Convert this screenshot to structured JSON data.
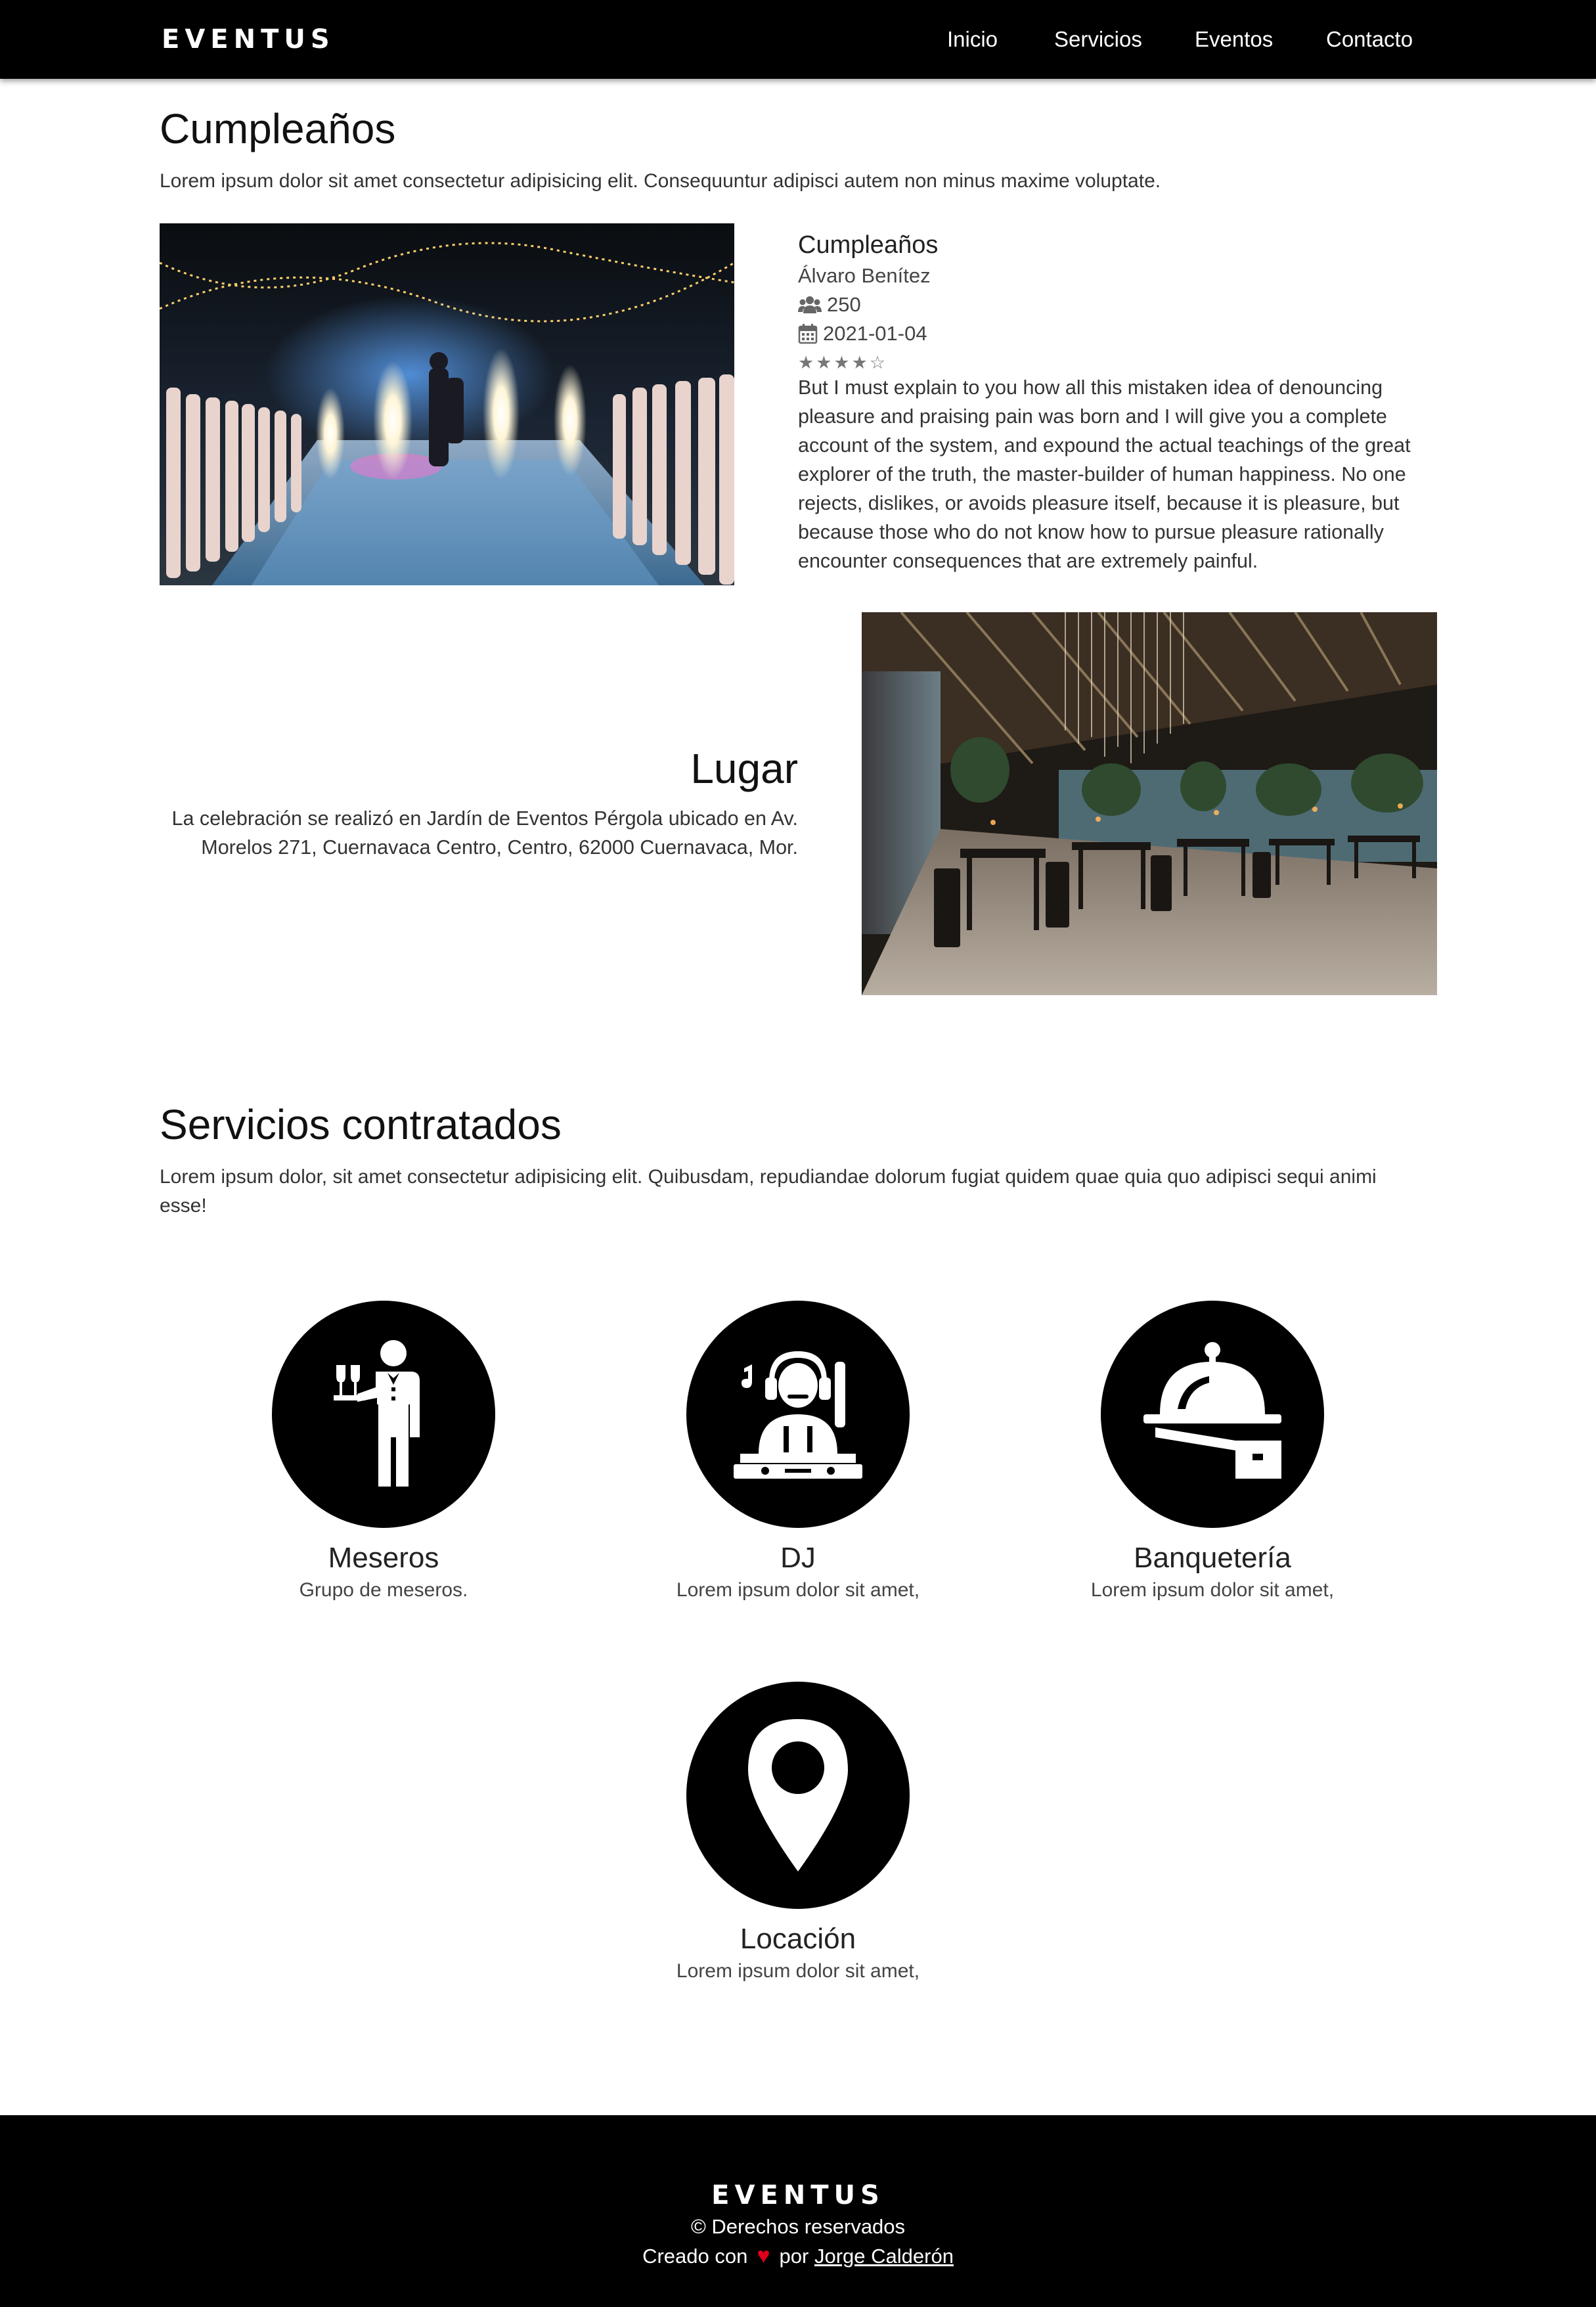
{
  "navbar": {
    "brand": "EVENTUS",
    "links": [
      "Inicio",
      "Servicios",
      "Eventos",
      "Contacto"
    ]
  },
  "event": {
    "section_title": "Cumpleaños",
    "intro": "Lorem ipsum dolor sit amet consectetur adipisicing elit. Consequuntur adipisci autem non minus maxime voluptate.",
    "type": "Cumpleaños",
    "client": "Álvaro Benítez",
    "guests": "250",
    "date": "2021-01-04",
    "rating": 4,
    "rating_max": 5,
    "rating_text": "★★★★☆",
    "description": "But I must explain to you how all this mistaken idea of denouncing pleasure and praising pain was born and I will give you a complete account of the system, and expound the actual teachings of the great explorer of the truth, the master-builder of human happiness. No one rejects, dislikes, or avoids pleasure itself, because it is pleasure, but because those who do not know how to pursue pleasure rationally encounter consequences that are extremely painful."
  },
  "place": {
    "title": "Lugar",
    "text": "La celebración se realizó en Jardín de Eventos Pérgola ubicado en Av. Morelos 271, Cuernavaca Centro, Centro, 62000 Cuernavaca, Mor."
  },
  "services": {
    "title": "Servicios contratados",
    "intro": "Lorem ipsum dolor, sit amet consectetur adipisicing elit. Quibusdam, repudiandae dolorum fugiat quidem quae quia quo adipisci sequi animi esse!",
    "items": [
      {
        "name": "Meseros",
        "desc": "Grupo de meseros.",
        "icon": "waiter-icon"
      },
      {
        "name": "DJ",
        "desc": "Lorem ipsum dolor sit amet,",
        "icon": "dj-icon"
      },
      {
        "name": "Banquetería",
        "desc": "Lorem ipsum dolor sit amet,",
        "icon": "food-tray-icon"
      },
      {
        "name": "Locación",
        "desc": "Lorem ipsum dolor sit amet,",
        "icon": "location-pin-icon"
      }
    ]
  },
  "footer": {
    "brand": "EVENTUS",
    "rights": "© Derechos reservados",
    "created_prefix": "Creado con",
    "created_by": "por",
    "author": "Jorge Calderón"
  },
  "colors": {
    "navbar": "#000000",
    "footer": "#000000",
    "heart": "#e0001b"
  }
}
